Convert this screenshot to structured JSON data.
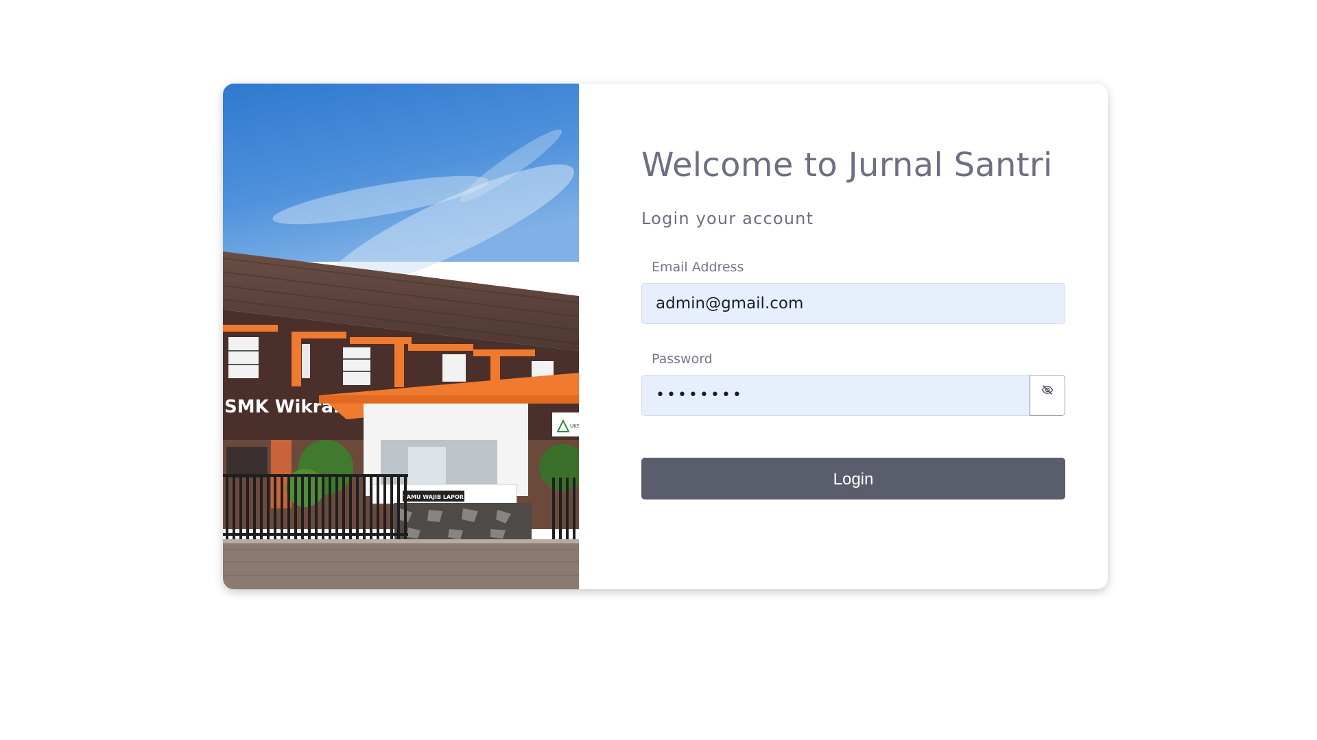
{
  "photo": {
    "sign_text": "SMK Wikrama",
    "booth_sign": "TAMU WAJIB LAPOR",
    "uks_text": "UKS"
  },
  "login": {
    "title": "Welcome to Jurnal Santri",
    "subtitle": "Login your account",
    "email_label": "Email Address",
    "email_value": "admin@gmail.com",
    "password_label": "Password",
    "password_value": "••••••••",
    "toggle_icon": "eye-slash-icon",
    "submit_label": "Login"
  },
  "colors": {
    "button": "#5a5d6b",
    "input_background": "#e8effc",
    "title_text": "#6d6f82",
    "sky": "#3f86d8",
    "accent_orange": "#f07a2e"
  }
}
